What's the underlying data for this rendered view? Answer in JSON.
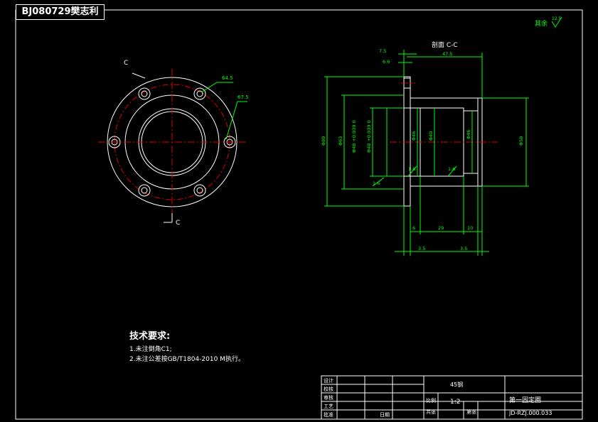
{
  "drawing_tag": "BJ080729樊志利",
  "section": {
    "title": "剖面 C-C",
    "marker": "C"
  },
  "roughness": {
    "prefix": "其余",
    "value": "12.5"
  },
  "front_view": {
    "dims": [
      "64.5",
      "67.5"
    ]
  },
  "section_view": {
    "dims": {
      "top1": "7.5",
      "top2": "6.6",
      "top3": "47.5",
      "d_outer": "Φ80",
      "d2": "Φ63",
      "d3": "Φ48 +0.039 0",
      "d4": "Φ48 +0.039 0",
      "d5": "Φ46",
      "d6": "Φ40",
      "d7": "Φ46",
      "d_right": "Φ50",
      "bot1": "6",
      "bot2": "29",
      "bot3": "10",
      "bot4": "3.5",
      "bot5": "3.5",
      "ch1": "1.6",
      "ch2": "1.6",
      "ch3": "1.6"
    }
  },
  "notes": {
    "heading": "技术要求:",
    "items": [
      "1.未注倒角C1;",
      "2.未注公差按GB/T1804-2010 M执行。"
    ]
  },
  "title_block": {
    "design": "设计",
    "check": "校核",
    "audit": "审核",
    "craft": "工艺",
    "approve": "批准",
    "date": "日期",
    "material": "45钢",
    "scale_label": "比例",
    "scale": "1:2",
    "qty_label": "共张",
    "sheet_label": "第张",
    "name": "第一固定圈",
    "code": "JD-RZJ.000.033"
  }
}
